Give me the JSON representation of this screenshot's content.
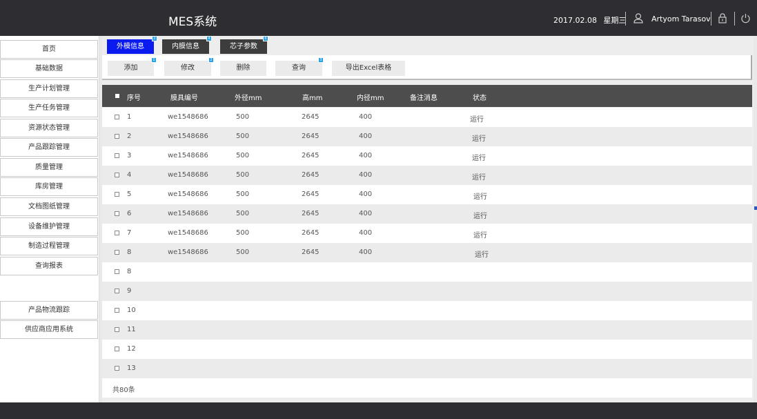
{
  "header": {
    "title": "MES系统",
    "date": "2017.02.08",
    "weekday": "星期三",
    "user": "Artyom Tarasov"
  },
  "sidebar": {
    "items": [
      "首页",
      "基础数据",
      "生产计划管理",
      "生产任务管理",
      "资源状态管理",
      "产品跟踪管理",
      "质量管理",
      "库房管理",
      "文档图纸管理",
      "设备维护管理",
      "制造过程管理",
      "查询报表"
    ],
    "extra": [
      "产品物流跟踪",
      "供应商应用系统"
    ]
  },
  "tabs": [
    {
      "label": "外模信息",
      "badge": "2"
    },
    {
      "label": "内膜信息",
      "badge": "4"
    },
    {
      "label": "芯子参数",
      "badge": "6"
    }
  ],
  "toolbar": {
    "add": "添加",
    "add_badge": "1",
    "edit": "修改",
    "edit_badge": "2",
    "delete": "删除",
    "query": "查询",
    "query_badge": "3",
    "export": "导出Excel表格"
  },
  "table": {
    "columns": [
      "序号",
      "膜具编号",
      "外径mm",
      "高mm",
      "内径mm",
      "备注消息",
      "状态"
    ],
    "rows": [
      {
        "no": "1",
        "code": "we1548686",
        "outer": "500",
        "height": "2645",
        "inner": "400",
        "note": "",
        "status": "运行"
      },
      {
        "no": "2",
        "code": "we1548686",
        "outer": "500",
        "height": "2645",
        "inner": "400",
        "note": "",
        "status": "运行"
      },
      {
        "no": "3",
        "code": "we1548686",
        "outer": "500",
        "height": "2645",
        "inner": "400",
        "note": "",
        "status": "运行"
      },
      {
        "no": "4",
        "code": "we1548686",
        "outer": "500",
        "height": "2645",
        "inner": "400",
        "note": "",
        "status": "运行"
      },
      {
        "no": "5",
        "code": "we1548686",
        "outer": "500",
        "height": "2645",
        "inner": "400",
        "note": "",
        "status": "运行"
      },
      {
        "no": "6",
        "code": "we1548686",
        "outer": "500",
        "height": "2645",
        "inner": "400",
        "note": "",
        "status": "运行"
      },
      {
        "no": "7",
        "code": "we1548686",
        "outer": "500",
        "height": "2645",
        "inner": "400",
        "note": "",
        "status": "运行"
      },
      {
        "no": "8",
        "code": "we1548686",
        "outer": "500",
        "height": "2645",
        "inner": "400",
        "note": "",
        "status": "运行"
      },
      {
        "no": "8",
        "code": "",
        "outer": "",
        "height": "",
        "inner": "",
        "note": "",
        "status": ""
      },
      {
        "no": "9",
        "code": "",
        "outer": "",
        "height": "",
        "inner": "",
        "note": "",
        "status": ""
      },
      {
        "no": "10",
        "code": "",
        "outer": "",
        "height": "",
        "inner": "",
        "note": "",
        "status": ""
      },
      {
        "no": "11",
        "code": "",
        "outer": "",
        "height": "",
        "inner": "",
        "note": "",
        "status": ""
      },
      {
        "no": "12",
        "code": "",
        "outer": "",
        "height": "",
        "inner": "",
        "note": "",
        "status": ""
      },
      {
        "no": "13",
        "code": "",
        "outer": "",
        "height": "",
        "inner": "",
        "note": "",
        "status": ""
      }
    ],
    "total": "共80条"
  },
  "icons": {
    "user": "user-icon",
    "lock": "lock-icon",
    "power": "power-icon"
  },
  "colors": {
    "header_bg": "#2e2e32",
    "active_tab": "#0a1bf0",
    "badge": "#2aa0e8",
    "table_header": "#4d4d4d"
  }
}
